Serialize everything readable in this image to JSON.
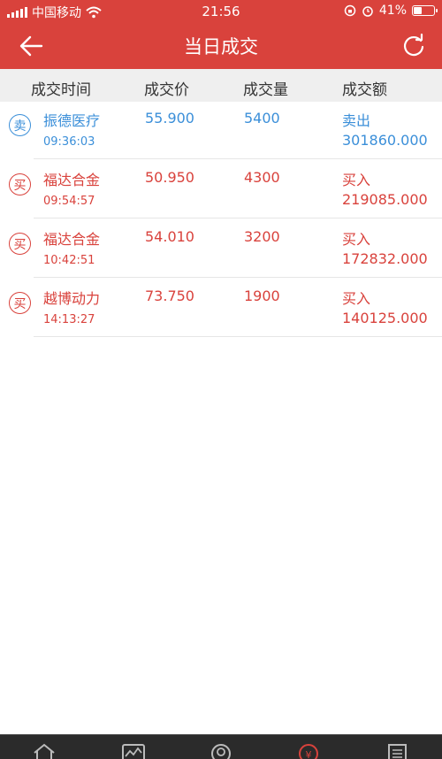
{
  "status_bar": {
    "carrier": "中国移动",
    "time": "21:56",
    "battery_percent": "41%",
    "battery_level": 0.41
  },
  "nav": {
    "title": "当日成交"
  },
  "columns": {
    "time": "成交时间",
    "price": "成交价",
    "volume": "成交量",
    "amount": "成交额"
  },
  "trades": [
    {
      "badge": "卖",
      "name": "振德医疗",
      "time": "09:36:03",
      "price": "55.900",
      "volume": "5400",
      "side": "卖出",
      "amount": "301860.000",
      "type": "sell"
    },
    {
      "badge": "买",
      "name": "福达合金",
      "time": "09:54:57",
      "price": "50.950",
      "volume": "4300",
      "side": "买入",
      "amount": "219085.000",
      "type": "buy"
    },
    {
      "badge": "买",
      "name": "福达合金",
      "time": "10:42:51",
      "price": "54.010",
      "volume": "3200",
      "side": "买入",
      "amount": "172832.000",
      "type": "buy"
    },
    {
      "badge": "买",
      "name": "越博动力",
      "time": "14:13:27",
      "price": "73.750",
      "volume": "1900",
      "side": "买入",
      "amount": "140125.000",
      "type": "buy"
    }
  ],
  "colors": {
    "brand_red": "#d9423c",
    "sell_blue": "#3b8fd9",
    "buy_red": "#d9423c",
    "tabbar_bg": "#2b2b2b"
  },
  "tabbar": {
    "tabs": [
      "home-icon",
      "market-icon",
      "watchlist-icon",
      "trade-icon",
      "news-icon"
    ],
    "active_index": 3
  }
}
